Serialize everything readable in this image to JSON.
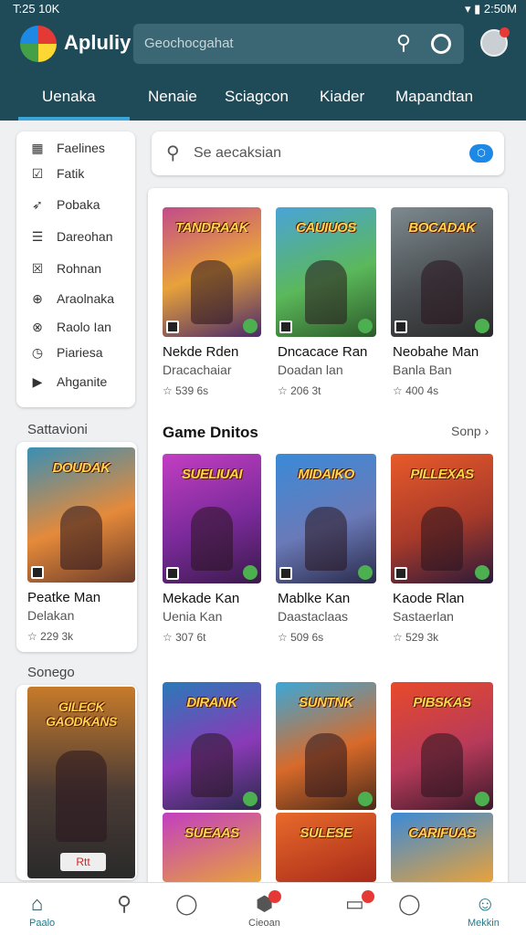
{
  "status": {
    "time": "T:25 10K",
    "indicators": "▾ ▮ 2:50M"
  },
  "header": {
    "app_name": "Apluliy",
    "search_placeholder": "Geochocgahat",
    "search_icon": "search-icon",
    "profile_icon": "circle-icon"
  },
  "tabs": [
    "Uenaka",
    "Nenaie",
    "Sciagcon",
    "Kiader",
    "Mapandtan"
  ],
  "sidebar": {
    "items": [
      {
        "label": "Faelines",
        "icon": "grid-icon"
      },
      {
        "label": "Fatik",
        "icon": "check-box-icon"
      },
      {
        "label": "Pobaka",
        "icon": "send-icon"
      },
      {
        "label": "Dareohan",
        "icon": "list-icon"
      },
      {
        "label": "Rohnan",
        "icon": "check-box-icon"
      },
      {
        "label": "Araolnaka",
        "icon": "download-icon"
      },
      {
        "label": "Raolo Ian",
        "icon": "globe-icon"
      },
      {
        "label": "Piariesa",
        "icon": "clock-icon"
      },
      {
        "label": "Ahganite",
        "icon": "play-icon"
      }
    ]
  },
  "left_section1": {
    "label": "Sattavioni",
    "game": {
      "thumb_title": "DOUDAK",
      "name": "Peatke Man",
      "sub": "Delakan",
      "rating": "229 3k"
    }
  },
  "left_section2": {
    "label": "Sonego",
    "game": {
      "thumb_title": "GILECK GAODKANS",
      "button": "Rtt"
    }
  },
  "search2": {
    "placeholder": "Se aecaksian"
  },
  "row1": [
    {
      "thumb_title": "TANDRAAK",
      "name": "Nekde Rden",
      "sub": "Dracachaiar",
      "rating": "539 6s"
    },
    {
      "thumb_title": "CAUIUOS",
      "name": "Dncacace Ran",
      "sub": "Doadan lan",
      "rating": "206 3t"
    },
    {
      "thumb_title": "BOCADAK",
      "name": "Neobahe Man",
      "sub": "Banla Ban",
      "rating": "400 4s"
    }
  ],
  "section_game": {
    "title": "Game Dnitos",
    "more": "Sonp"
  },
  "row2": [
    {
      "thumb_title": "SUELIUAI",
      "name": "Mekade Kan",
      "sub": "Uenia Kan",
      "rating": "307 6t"
    },
    {
      "thumb_title": "MIDAIKO",
      "name": "Mablke Kan",
      "sub": "Daastaclaas",
      "rating": "509 6s"
    },
    {
      "thumb_title": "PILLEXAS",
      "name": "Kaode Rlan",
      "sub": "Sastaerlan",
      "rating": "529 3k"
    }
  ],
  "row3": [
    {
      "thumb_title": "DIRANK"
    },
    {
      "thumb_title": "SUNTNK"
    },
    {
      "thumb_title": "PIBSKAS"
    }
  ],
  "row4": [
    {
      "thumb_title": "SUEAAS"
    },
    {
      "thumb_title": "SULESE"
    },
    {
      "thumb_title": "CARIFUAS"
    }
  ],
  "bottom_nav": [
    {
      "label": "Paalo",
      "icon": "home-icon"
    },
    {
      "label": "",
      "icon": "search-icon"
    },
    {
      "label": "",
      "icon": "circle-icon"
    },
    {
      "label": "Cieoan",
      "icon": "gamepad-icon"
    },
    {
      "label": "",
      "icon": "library-icon"
    },
    {
      "label": "",
      "icon": "circle-icon"
    },
    {
      "label": "Mekkin",
      "icon": "profile-icon"
    }
  ],
  "colors": {
    "header": "#1f4a58",
    "tab_accent": "#3aa5d6",
    "badge": "#e53935",
    "active_nav": "#1f7a8c"
  }
}
